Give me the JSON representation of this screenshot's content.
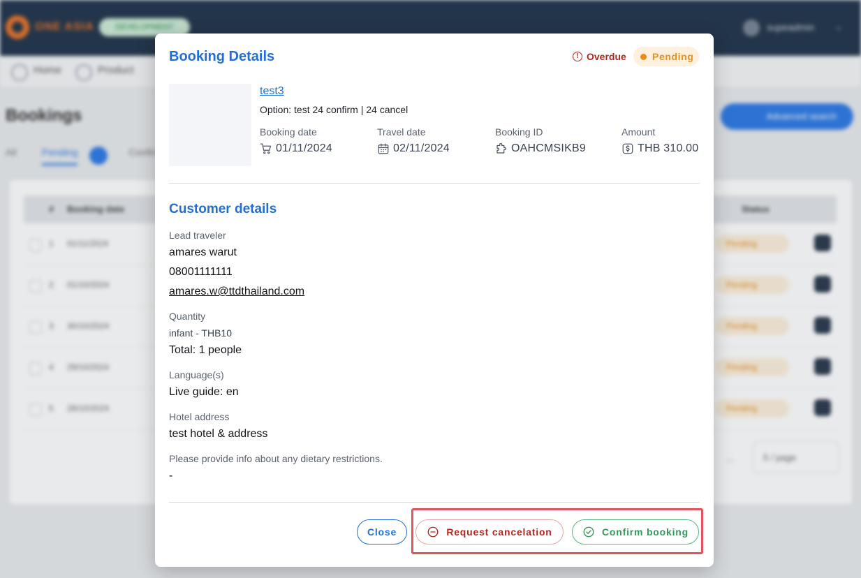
{
  "background": {
    "logo_text": "ONE ASIA",
    "env_badge": "DEVELOPMENT",
    "user_name": "supeadmin",
    "breadcrumbs": [
      "Home",
      "Product"
    ],
    "page_title": "Bookings",
    "advanced_search": "Advanced search",
    "tabs": [
      "All",
      "Pending",
      "Confirmed"
    ],
    "table_headers": [
      "#",
      "Booking date",
      "Status"
    ],
    "rows": [
      {
        "num": "1",
        "date": "01/11/2024",
        "status": "Pending"
      },
      {
        "num": "2",
        "date": "01/10/2024",
        "status": "Pending"
      },
      {
        "num": "3",
        "date": "30/10/2024",
        "status": "Pending"
      },
      {
        "num": "4",
        "date": "29/10/2024",
        "status": "Pending"
      },
      {
        "num": "5",
        "date": "28/10/2024",
        "status": "Pending"
      }
    ],
    "pager_dots": "...",
    "page_size": "5 / page"
  },
  "modal": {
    "title": "Booking Details",
    "overdue_label": "Overdue",
    "status_label": "Pending",
    "product": {
      "name": "test3",
      "option": "Option: test 24 confirm | 24 cancel"
    },
    "info": {
      "booking_date_label": "Booking date",
      "booking_date": "01/11/2024",
      "travel_date_label": "Travel date",
      "travel_date": "02/11/2024",
      "booking_id_label": "Booking ID",
      "booking_id": "OAHCMSIKB9",
      "amount_label": "Amount",
      "amount": "THB 310.00"
    },
    "customer": {
      "section_title": "Customer details",
      "lead_label": "Lead traveler",
      "lead_name": "amares warut",
      "lead_phone": "08001111111",
      "lead_email": "amares.w@ttdthailand.com",
      "quantity_label": "Quantity",
      "quantity_item": "infant - THB10",
      "quantity_total": "Total: 1 people",
      "language_label": "Language(s)",
      "language_value": "Live guide: en",
      "hotel_label": "Hotel address",
      "hotel_value": "test hotel & address",
      "dietary_label": "Please provide info about any dietary restrictions.",
      "dietary_value": "-"
    },
    "buttons": {
      "close": "Close",
      "request_cancel": "Request cancelation",
      "confirm": "Confirm booking"
    }
  },
  "colors": {
    "accent": "#1f6fd6",
    "overdue": "#b3261e",
    "pending": "#e8901f",
    "confirm": "#2f9a55",
    "highlight": "#e2545a"
  }
}
